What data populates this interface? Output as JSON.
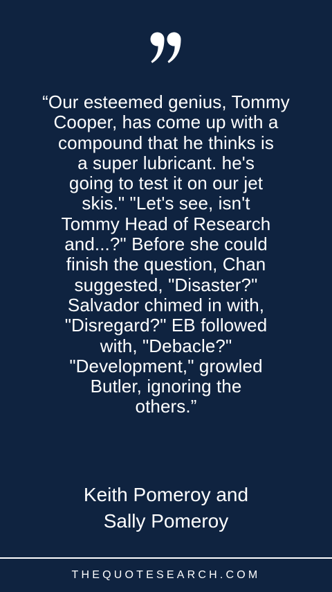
{
  "quote_icon": "closing-double-quote-icon",
  "quote": {
    "lines": [
      "“Our esteemed genius, Tommy",
      "Cooper, has come up with a",
      "compound that he thinks is",
      "a super lubricant. he's",
      "going to test it on our jet",
      "skis.\"  \"Let's see, isn't",
      "Tommy Head of Research",
      "and...?\" Before she could",
      "finish the question, Chan",
      "suggested, \"Disaster?\"",
      "Salvador chimed in with,",
      "\"Disregard?\" EB followed",
      "with, \"Debacle?\"",
      "\"Development,\" growled",
      "Butler, ignoring the",
      "others.”"
    ]
  },
  "author": {
    "lines": [
      "Keith Pomeroy and",
      "Sally Pomeroy"
    ]
  },
  "footer": {
    "site": "THEQUOTESEARCH.COM"
  },
  "colors": {
    "background": "#0f2340",
    "text": "#ffffff"
  }
}
